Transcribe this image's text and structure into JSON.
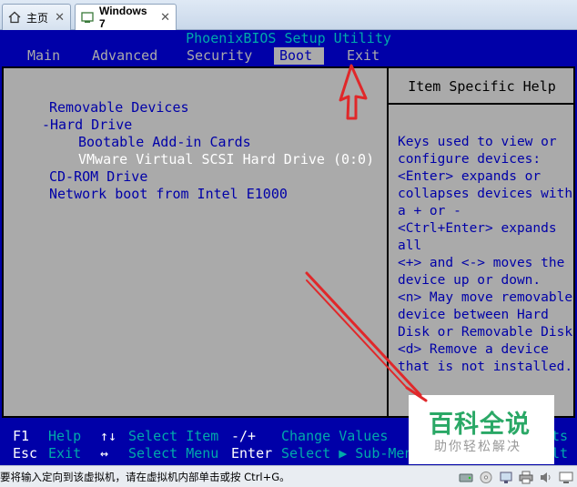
{
  "host": {
    "tabs": [
      {
        "label": "主页",
        "icon": "home-icon"
      },
      {
        "label": "Windows 7",
        "icon": "vm-icon"
      }
    ],
    "close_glyph": "✕",
    "status_text": "要将输入定向到该虚拟机，请在虚拟机内部单击或按 Ctrl+G。"
  },
  "bios": {
    "title": "PhoenixBIOS Setup Utility",
    "menu": [
      "Main",
      "Advanced",
      "Security",
      "Boot",
      "Exit"
    ],
    "active_menu": "Boot",
    "boot_list": [
      "Removable Devices",
      "-Hard Drive",
      "Bootable Add-in Cards",
      "VMware Virtual SCSI Hard Drive (0:0)",
      "CD-ROM Drive",
      "Network boot from Intel E1000"
    ],
    "help_title": "Item Specific Help",
    "help_lines": [
      "Keys used to view or",
      "configure devices:",
      "<Enter> expands or",
      "collapses devices with",
      "a + or -",
      "<Ctrl+Enter> expands",
      "all",
      "<+> and <-> moves the",
      "device up or down.",
      "<n> May move removable",
      "device between Hard",
      "Disk or Removable Disk",
      "<d> Remove a device",
      "that is not installed."
    ],
    "footer": {
      "row1": {
        "k1": "F1",
        "d1": "Help",
        "k2": "↑↓",
        "d2": "Select Item",
        "k3": "-/+",
        "d3": "Change Values",
        "tail": "ts"
      },
      "row2": {
        "k1": "Esc",
        "d1": "Exit",
        "k2": "↔",
        "d2": "Select Menu",
        "k3": "Enter",
        "d3": "Select ▶ Sub-Menu",
        "tail": "lt"
      }
    }
  },
  "watermark": {
    "line1": "百科全说",
    "line2": "助你轻松解决"
  },
  "colors": {
    "bios_blue": "#0000a8",
    "bios_gray": "#aaaaaa",
    "cyan": "#00aaaa",
    "arrow_red": "#e0282a"
  }
}
